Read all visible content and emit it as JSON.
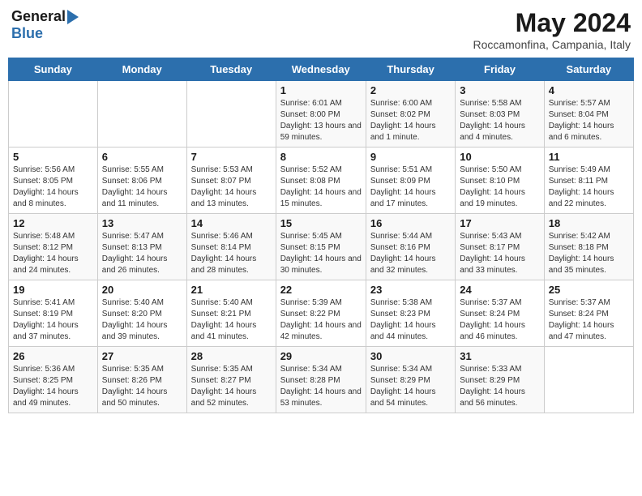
{
  "logo": {
    "general": "General",
    "blue": "Blue"
  },
  "header": {
    "month": "May 2024",
    "location": "Roccamonfina, Campania, Italy"
  },
  "weekdays": [
    "Sunday",
    "Monday",
    "Tuesday",
    "Wednesday",
    "Thursday",
    "Friday",
    "Saturday"
  ],
  "weeks": [
    [
      {
        "day": "",
        "info": ""
      },
      {
        "day": "",
        "info": ""
      },
      {
        "day": "",
        "info": ""
      },
      {
        "day": "1",
        "info": "Sunrise: 6:01 AM\nSunset: 8:00 PM\nDaylight: 13 hours and 59 minutes."
      },
      {
        "day": "2",
        "info": "Sunrise: 6:00 AM\nSunset: 8:02 PM\nDaylight: 14 hours and 1 minute."
      },
      {
        "day": "3",
        "info": "Sunrise: 5:58 AM\nSunset: 8:03 PM\nDaylight: 14 hours and 4 minutes."
      },
      {
        "day": "4",
        "info": "Sunrise: 5:57 AM\nSunset: 8:04 PM\nDaylight: 14 hours and 6 minutes."
      }
    ],
    [
      {
        "day": "5",
        "info": "Sunrise: 5:56 AM\nSunset: 8:05 PM\nDaylight: 14 hours and 8 minutes."
      },
      {
        "day": "6",
        "info": "Sunrise: 5:55 AM\nSunset: 8:06 PM\nDaylight: 14 hours and 11 minutes."
      },
      {
        "day": "7",
        "info": "Sunrise: 5:53 AM\nSunset: 8:07 PM\nDaylight: 14 hours and 13 minutes."
      },
      {
        "day": "8",
        "info": "Sunrise: 5:52 AM\nSunset: 8:08 PM\nDaylight: 14 hours and 15 minutes."
      },
      {
        "day": "9",
        "info": "Sunrise: 5:51 AM\nSunset: 8:09 PM\nDaylight: 14 hours and 17 minutes."
      },
      {
        "day": "10",
        "info": "Sunrise: 5:50 AM\nSunset: 8:10 PM\nDaylight: 14 hours and 19 minutes."
      },
      {
        "day": "11",
        "info": "Sunrise: 5:49 AM\nSunset: 8:11 PM\nDaylight: 14 hours and 22 minutes."
      }
    ],
    [
      {
        "day": "12",
        "info": "Sunrise: 5:48 AM\nSunset: 8:12 PM\nDaylight: 14 hours and 24 minutes."
      },
      {
        "day": "13",
        "info": "Sunrise: 5:47 AM\nSunset: 8:13 PM\nDaylight: 14 hours and 26 minutes."
      },
      {
        "day": "14",
        "info": "Sunrise: 5:46 AM\nSunset: 8:14 PM\nDaylight: 14 hours and 28 minutes."
      },
      {
        "day": "15",
        "info": "Sunrise: 5:45 AM\nSunset: 8:15 PM\nDaylight: 14 hours and 30 minutes."
      },
      {
        "day": "16",
        "info": "Sunrise: 5:44 AM\nSunset: 8:16 PM\nDaylight: 14 hours and 32 minutes."
      },
      {
        "day": "17",
        "info": "Sunrise: 5:43 AM\nSunset: 8:17 PM\nDaylight: 14 hours and 33 minutes."
      },
      {
        "day": "18",
        "info": "Sunrise: 5:42 AM\nSunset: 8:18 PM\nDaylight: 14 hours and 35 minutes."
      }
    ],
    [
      {
        "day": "19",
        "info": "Sunrise: 5:41 AM\nSunset: 8:19 PM\nDaylight: 14 hours and 37 minutes."
      },
      {
        "day": "20",
        "info": "Sunrise: 5:40 AM\nSunset: 8:20 PM\nDaylight: 14 hours and 39 minutes."
      },
      {
        "day": "21",
        "info": "Sunrise: 5:40 AM\nSunset: 8:21 PM\nDaylight: 14 hours and 41 minutes."
      },
      {
        "day": "22",
        "info": "Sunrise: 5:39 AM\nSunset: 8:22 PM\nDaylight: 14 hours and 42 minutes."
      },
      {
        "day": "23",
        "info": "Sunrise: 5:38 AM\nSunset: 8:23 PM\nDaylight: 14 hours and 44 minutes."
      },
      {
        "day": "24",
        "info": "Sunrise: 5:37 AM\nSunset: 8:24 PM\nDaylight: 14 hours and 46 minutes."
      },
      {
        "day": "25",
        "info": "Sunrise: 5:37 AM\nSunset: 8:24 PM\nDaylight: 14 hours and 47 minutes."
      }
    ],
    [
      {
        "day": "26",
        "info": "Sunrise: 5:36 AM\nSunset: 8:25 PM\nDaylight: 14 hours and 49 minutes."
      },
      {
        "day": "27",
        "info": "Sunrise: 5:35 AM\nSunset: 8:26 PM\nDaylight: 14 hours and 50 minutes."
      },
      {
        "day": "28",
        "info": "Sunrise: 5:35 AM\nSunset: 8:27 PM\nDaylight: 14 hours and 52 minutes."
      },
      {
        "day": "29",
        "info": "Sunrise: 5:34 AM\nSunset: 8:28 PM\nDaylight: 14 hours and 53 minutes."
      },
      {
        "day": "30",
        "info": "Sunrise: 5:34 AM\nSunset: 8:29 PM\nDaylight: 14 hours and 54 minutes."
      },
      {
        "day": "31",
        "info": "Sunrise: 5:33 AM\nSunset: 8:29 PM\nDaylight: 14 hours and 56 minutes."
      },
      {
        "day": "",
        "info": ""
      }
    ]
  ]
}
